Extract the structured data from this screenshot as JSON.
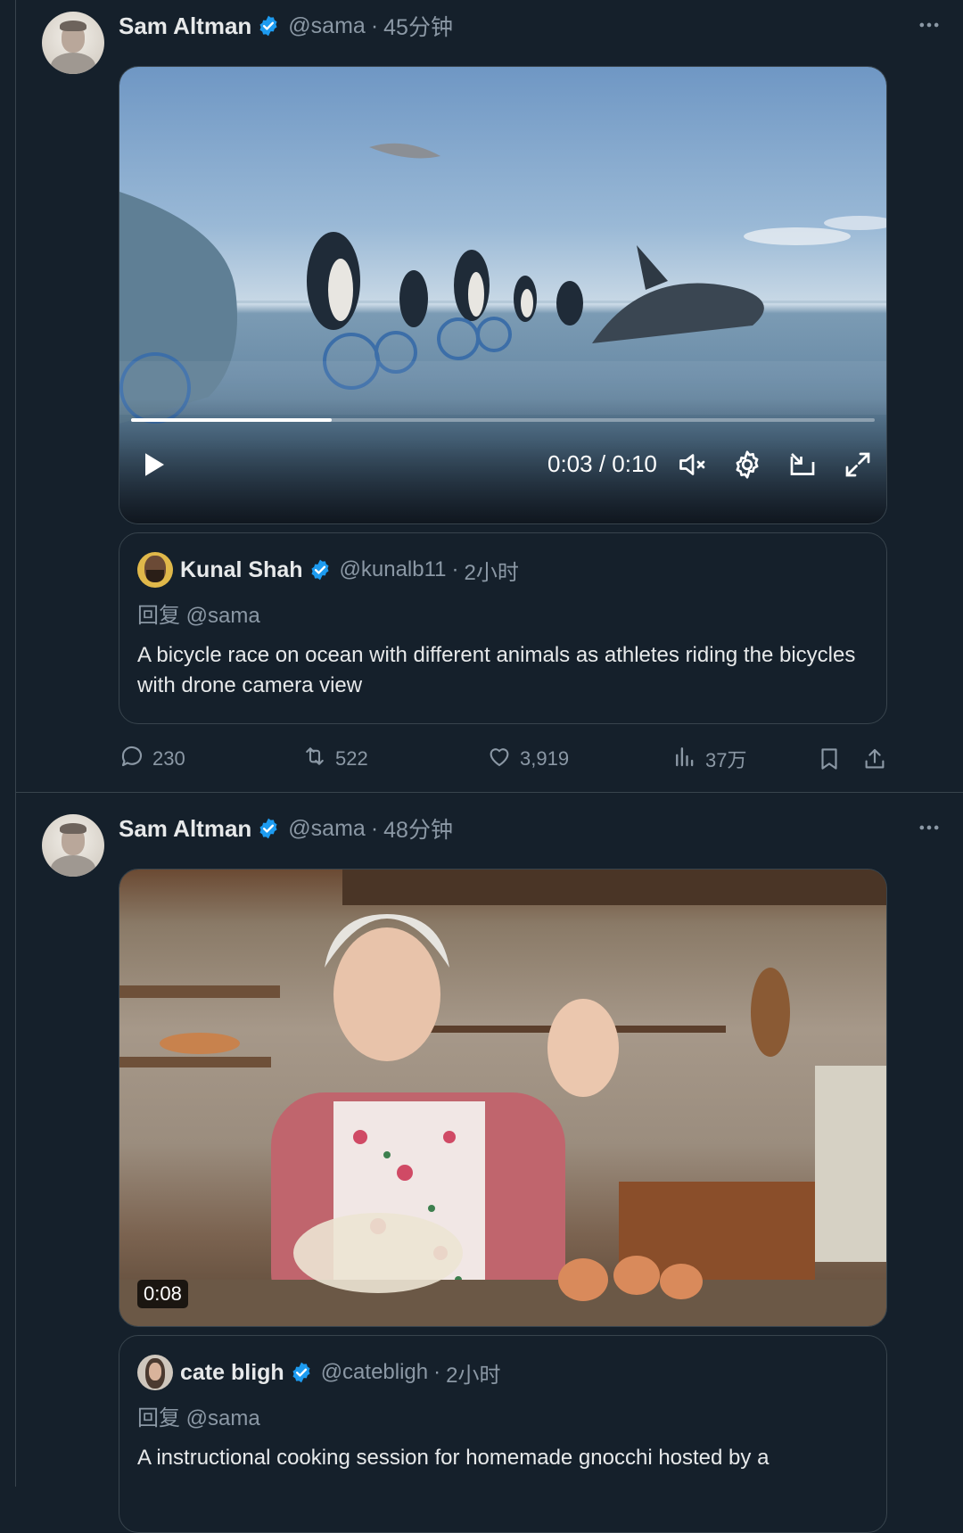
{
  "tweets": [
    {
      "author": {
        "name": "Sam Altman",
        "handle": "@sama",
        "time": "45分钟",
        "verified": true
      },
      "media": {
        "type": "video",
        "current_time": "0:03",
        "duration": "0:10",
        "time_display": "0:03 / 0:10",
        "progress": 0.27
      },
      "quote": {
        "author": {
          "name": "Kunal Shah",
          "handle": "@kunalb11",
          "time": "2小时",
          "verified": true
        },
        "reply_to": "回复 @sama",
        "text": "A bicycle race on ocean with different animals as athletes riding the bicycles with drone camera view"
      },
      "actions": {
        "replies": "230",
        "retweets": "522",
        "likes": "3,919",
        "views": "37万"
      }
    },
    {
      "author": {
        "name": "Sam Altman",
        "handle": "@sama",
        "time": "48分钟",
        "verified": true
      },
      "media": {
        "type": "video",
        "duration_badge": "0:08"
      },
      "quote": {
        "author": {
          "name": "cate bligh",
          "handle": "@catebligh",
          "time": "2小时",
          "verified": true
        },
        "reply_to": "回复 @sama",
        "text": "A instructional cooking session for homemade gnocchi hosted by a"
      }
    }
  ],
  "colors": {
    "background": "#15202b",
    "border": "#38444d",
    "muted": "#8b98a5",
    "verified": "#1d9bf0",
    "text": "#e7e9ea"
  },
  "icons": [
    "more-icon",
    "verified-badge-icon",
    "play-icon",
    "mute-icon",
    "settings-icon",
    "pip-icon",
    "fullscreen-icon",
    "reply-icon",
    "retweet-icon",
    "like-icon",
    "views-icon",
    "bookmark-icon",
    "share-icon"
  ]
}
